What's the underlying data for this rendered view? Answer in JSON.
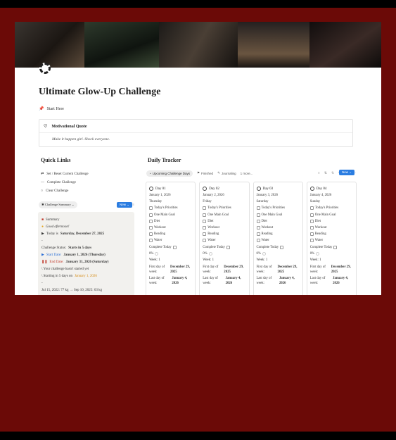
{
  "page": {
    "title": "Ultimate Glow-Up Challenge",
    "start_here": "Start Here"
  },
  "quote": {
    "heading": "Motivational Quote",
    "text": "Make it happen girl. Shock everyone."
  },
  "quick_links": {
    "title": "Quick Links",
    "items": [
      {
        "icon": "refresh-icon",
        "label": "Set / Reset Current Challenge"
      },
      {
        "icon": "dash-icon",
        "label": "Complete Challenge"
      },
      {
        "icon": "circle-icon",
        "label": "Clear Challenge"
      }
    ],
    "view_tab": "Challenge Summary",
    "new_label": "New"
  },
  "summary": {
    "heading": "Summary",
    "greeting": "Good afternoon!",
    "today_prefix": "Today is",
    "today_value": "Saturday, December 27, 2025",
    "dash1": "-",
    "status_prefix": "Challenge Status:",
    "status_value": "Starts in 5 days",
    "start_prefix": "Start Date:",
    "start_value": "January 1, 2026 (Thursday)",
    "end_prefix": "End Date:",
    "end_value": "January 31, 2026 (Saturday)",
    "not_started": "\\ Your challenge hasn't started yet",
    "starting_prefix": "\\ Starting in 5 days on",
    "starting_date": "January 1, 2026",
    "dash2": "-",
    "weight_line": "Jul 15, 2022: 77 kg → Sep 10, 2025: 63 kg",
    "accent_blue": "#2b6fd6",
    "accent_red": "#c0392b",
    "accent_orange": "#d4880f"
  },
  "tracker": {
    "title": "Daily Tracker",
    "tabs": [
      {
        "label": "Upcoming Challenge Days",
        "active": true
      },
      {
        "label": "Finished",
        "active": false
      },
      {
        "label": "Journaling",
        "active": false
      },
      {
        "label": "1 more...",
        "active": false
      }
    ],
    "new_label": "New",
    "cards": [
      {
        "day": "Day 01",
        "date": "January 1, 2026",
        "weekday": "Thursday",
        "tasks": [
          "Today's Priorities",
          "One Main Goal",
          "Diet",
          "Workout",
          "Reading",
          "Water"
        ],
        "complete": "Complete Today",
        "percent": "0%",
        "week": "Week: 1",
        "first_day_label": "First day of week:",
        "first_day": "December 29, 2025",
        "last_day_label": "Last day of week:",
        "last_day": "January 4, 2026"
      },
      {
        "day": "Day 02",
        "date": "January 2, 2026",
        "weekday": "Friday",
        "tasks": [
          "Today's Priorities",
          "One Main Goal",
          "Diet",
          "Workout",
          "Reading",
          "Water"
        ],
        "complete": "Complete Today",
        "percent": "0%",
        "week": "Week: 1",
        "first_day_label": "First day of week:",
        "first_day": "December 29, 2025",
        "last_day_label": "Last day of week:",
        "last_day": "January 4, 2026"
      },
      {
        "day": "Day 03",
        "date": "January 3, 2026",
        "weekday": "Saturday",
        "tasks": [
          "Today's Priorities",
          "One Main Goal",
          "Diet",
          "Workout",
          "Reading",
          "Water"
        ],
        "complete": "Complete Today",
        "percent": "0%",
        "week": "Week: 1",
        "first_day_label": "First day of week:",
        "first_day": "December 29, 2025",
        "last_day_label": "Last day of week:",
        "last_day": "January 4, 2026"
      },
      {
        "day": "Day 04",
        "date": "January 4, 2026",
        "weekday": "Sunday",
        "tasks": [
          "Today's Priorities",
          "One Main Goal",
          "Diet",
          "Workout",
          "Reading",
          "Water"
        ],
        "complete": "Complete Today",
        "percent": "0%",
        "week": "Week: 1",
        "first_day_label": "First day of week:",
        "first_day": "December 29, 2025",
        "last_day_label": "Last day of week:",
        "last_day": "January 4, 2026"
      }
    ]
  }
}
